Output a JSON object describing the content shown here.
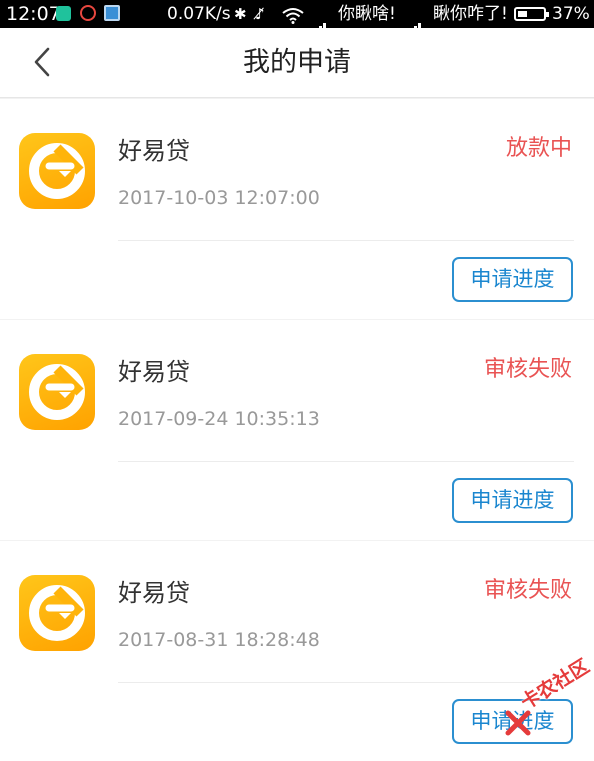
{
  "status_bar": {
    "time": "12:07",
    "net_speed": "0.07K/s",
    "carrier1": "你瞅啥!",
    "carrier2": "瞅你咋了!",
    "battery_level": 0.37,
    "battery_percent": "37%",
    "icons": [
      "wechat-notification-icon",
      "netease-music-icon",
      "photo-app-icon",
      "bluetooth-icon",
      "silent-mode-icon",
      "wifi-icon",
      "signal-icon",
      "battery-icon"
    ]
  },
  "header": {
    "title": "我的申请",
    "back_icon": "chevron-left-icon"
  },
  "colors": {
    "status_red": "#e95353",
    "button_blue": "#2b8fd0",
    "logo_orange": "#ffa200",
    "logo_yellow": "#ffc61a"
  },
  "applications": [
    {
      "product": "好易贷",
      "status": "放款中",
      "time": "2017-10-03 12:07:00",
      "action_label": "申请进度"
    },
    {
      "product": "好易贷",
      "status": "审核失败",
      "time": "2017-09-24 10:35:13",
      "action_label": "申请进度"
    },
    {
      "product": "好易贷",
      "status": "审核失败",
      "time": "2017-08-31 18:28:48",
      "action_label": "申请进度"
    }
  ],
  "watermark": {
    "text": "卡农社区"
  }
}
